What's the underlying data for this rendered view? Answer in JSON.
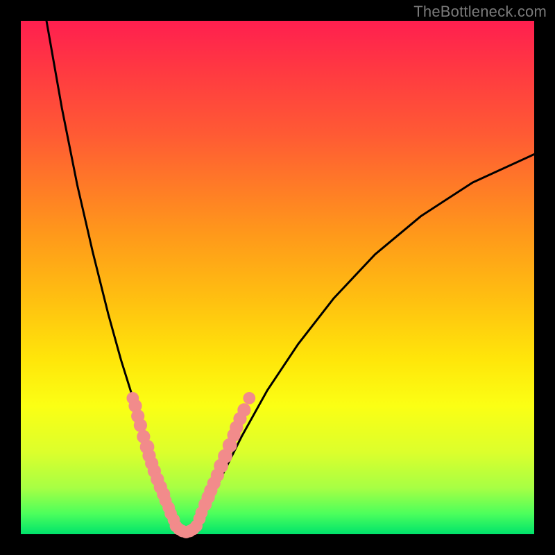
{
  "watermark": "TheBottleneck.com",
  "chart_data": {
    "type": "line",
    "title": "",
    "xlabel": "",
    "ylabel": "",
    "xlim": [
      0,
      100
    ],
    "ylim": [
      0,
      100
    ],
    "gradient_stops": [
      {
        "pos": 0,
        "color": "#ff1f4f"
      },
      {
        "pos": 10,
        "color": "#ff3a41"
      },
      {
        "pos": 22,
        "color": "#ff5a34"
      },
      {
        "pos": 32,
        "color": "#ff7a27"
      },
      {
        "pos": 42,
        "color": "#ff9a1a"
      },
      {
        "pos": 55,
        "color": "#ffc210"
      },
      {
        "pos": 66,
        "color": "#ffe60a"
      },
      {
        "pos": 75,
        "color": "#fbff14"
      },
      {
        "pos": 84,
        "color": "#dcff2c"
      },
      {
        "pos": 91,
        "color": "#a7ff44"
      },
      {
        "pos": 96,
        "color": "#4cff5c"
      },
      {
        "pos": 100,
        "color": "#00e36b"
      }
    ],
    "series": [
      {
        "name": "left-branch",
        "x": [
          5.0,
          8.0,
          11.0,
          14.0,
          17.0,
          19.5,
          22.0,
          24.0,
          26.0,
          27.5,
          29.0,
          30.0
        ],
        "y": [
          100.0,
          83.0,
          68.0,
          55.0,
          43.0,
          34.0,
          26.0,
          19.0,
          13.0,
          8.0,
          4.0,
          1.5
        ]
      },
      {
        "name": "valley",
        "x": [
          30.0,
          31.0,
          32.0,
          33.0,
          34.0
        ],
        "y": [
          1.5,
          0.6,
          0.3,
          0.6,
          1.5
        ]
      },
      {
        "name": "right-branch",
        "x": [
          34.0,
          36.0,
          39.0,
          43.0,
          48.0,
          54.0,
          61.0,
          69.0,
          78.0,
          88.0,
          100.0
        ],
        "y": [
          1.5,
          5.0,
          11.0,
          19.0,
          28.0,
          37.0,
          46.0,
          54.5,
          62.0,
          68.5,
          74.0
        ]
      }
    ],
    "dot_clusters": [
      {
        "name": "left-cluster",
        "color": "#f28b8b",
        "points": [
          {
            "x": 21.8,
            "y": 26.5,
            "r": 1.2
          },
          {
            "x": 22.3,
            "y": 25.0,
            "r": 1.3
          },
          {
            "x": 22.8,
            "y": 23.0,
            "r": 1.3
          },
          {
            "x": 23.3,
            "y": 21.2,
            "r": 1.3
          },
          {
            "x": 23.9,
            "y": 19.0,
            "r": 1.3
          },
          {
            "x": 24.6,
            "y": 17.0,
            "r": 1.4
          },
          {
            "x": 25.0,
            "y": 15.3,
            "r": 1.3
          },
          {
            "x": 25.5,
            "y": 13.8,
            "r": 1.3
          },
          {
            "x": 26.0,
            "y": 12.3,
            "r": 1.3
          },
          {
            "x": 26.6,
            "y": 10.7,
            "r": 1.3
          },
          {
            "x": 27.2,
            "y": 9.2,
            "r": 1.3
          },
          {
            "x": 27.8,
            "y": 7.8,
            "r": 1.3
          },
          {
            "x": 28.2,
            "y": 6.5,
            "r": 1.2
          },
          {
            "x": 28.8,
            "y": 5.2,
            "r": 1.2
          },
          {
            "x": 29.2,
            "y": 4.0,
            "r": 1.2
          },
          {
            "x": 29.8,
            "y": 2.8,
            "r": 1.2
          }
        ]
      },
      {
        "name": "bottom-cluster",
        "color": "#f28b8b",
        "points": [
          {
            "x": 30.2,
            "y": 1.6,
            "r": 1.2
          },
          {
            "x": 30.8,
            "y": 1.0,
            "r": 1.2
          },
          {
            "x": 31.5,
            "y": 0.6,
            "r": 1.2
          },
          {
            "x": 32.2,
            "y": 0.4,
            "r": 1.2
          },
          {
            "x": 32.9,
            "y": 0.6,
            "r": 1.2
          },
          {
            "x": 33.6,
            "y": 1.0,
            "r": 1.2
          },
          {
            "x": 34.2,
            "y": 1.6,
            "r": 1.2
          }
        ]
      },
      {
        "name": "right-cluster",
        "color": "#f28b8b",
        "points": [
          {
            "x": 34.8,
            "y": 3.0,
            "r": 1.2
          },
          {
            "x": 35.2,
            "y": 4.2,
            "r": 1.2
          },
          {
            "x": 35.9,
            "y": 5.8,
            "r": 1.3
          },
          {
            "x": 36.5,
            "y": 7.2,
            "r": 1.3
          },
          {
            "x": 37.0,
            "y": 8.5,
            "r": 1.3
          },
          {
            "x": 37.6,
            "y": 9.9,
            "r": 1.3
          },
          {
            "x": 38.3,
            "y": 11.5,
            "r": 1.3
          },
          {
            "x": 39.0,
            "y": 13.3,
            "r": 1.4
          },
          {
            "x": 39.8,
            "y": 15.2,
            "r": 1.4
          },
          {
            "x": 40.7,
            "y": 17.3,
            "r": 1.4
          },
          {
            "x": 41.5,
            "y": 19.3,
            "r": 1.3
          },
          {
            "x": 42.0,
            "y": 20.8,
            "r": 1.3
          },
          {
            "x": 42.7,
            "y": 22.5,
            "r": 1.3
          },
          {
            "x": 43.5,
            "y": 24.2,
            "r": 1.3
          },
          {
            "x": 44.5,
            "y": 26.5,
            "r": 1.2
          }
        ]
      }
    ]
  }
}
